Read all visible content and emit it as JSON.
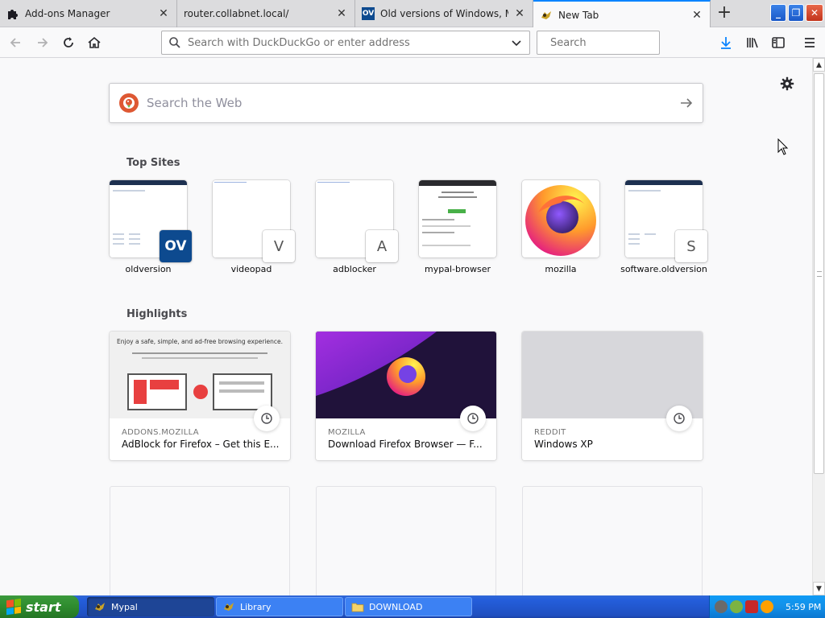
{
  "tabs": [
    {
      "title": "Add-ons Manager",
      "icon": "puzzle-icon",
      "active": false
    },
    {
      "title": "router.collabnet.local/",
      "icon": "none",
      "active": false
    },
    {
      "title": "Old versions of Windows, Mac and",
      "icon": "oldversion-icon",
      "favicon_text": "OV",
      "active": false
    },
    {
      "title": "New Tab",
      "icon": "mypal-icon",
      "active": true
    }
  ],
  "tab_close_symbol": "✕",
  "newtab_symbol": "+",
  "window_controls": {
    "minimize": "_",
    "maximize": "❐",
    "close": "✕"
  },
  "urlbar": {
    "placeholder": "Search with DuckDuckGo or enter address"
  },
  "searchbar": {
    "placeholder": "Search"
  },
  "websearch": {
    "placeholder": "Search the Web"
  },
  "top_sites": {
    "title": "Top Sites",
    "sites": [
      {
        "label": "oldversion",
        "tile": "OV"
      },
      {
        "label": "videopad",
        "tile": "V"
      },
      {
        "label": "adblocker",
        "tile": "A"
      },
      {
        "label": "mypal-browser",
        "tile": ""
      },
      {
        "label": "mozilla",
        "tile": ""
      },
      {
        "label": "software.oldversion",
        "tile": "S"
      }
    ]
  },
  "highlights": {
    "title": "Highlights",
    "cards": [
      {
        "source": "ADDONS.MOZILLA",
        "title": "AdBlock for Firefox – Get this E...",
        "image_text": "Enjoy a safe, simple, and ad-free browsing experience."
      },
      {
        "source": "MOZILLA",
        "title": "Download Firefox Browser — F..."
      },
      {
        "source": "REDDIT",
        "title": "Windows XP"
      }
    ]
  },
  "taskbar": {
    "start_label": "start",
    "tasks": [
      {
        "label": "Mypal",
        "active": true
      },
      {
        "label": "Library",
        "active": false
      },
      {
        "label": "DOWNLOAD",
        "active": false
      }
    ],
    "clock": "5:59 PM"
  },
  "colors": {
    "accent": "#0a84ff",
    "ddg": "#de5833",
    "firefox_purple": "#5c1fb8",
    "xp_blue": "#245edb",
    "xp_green": "#2e8b2e"
  }
}
